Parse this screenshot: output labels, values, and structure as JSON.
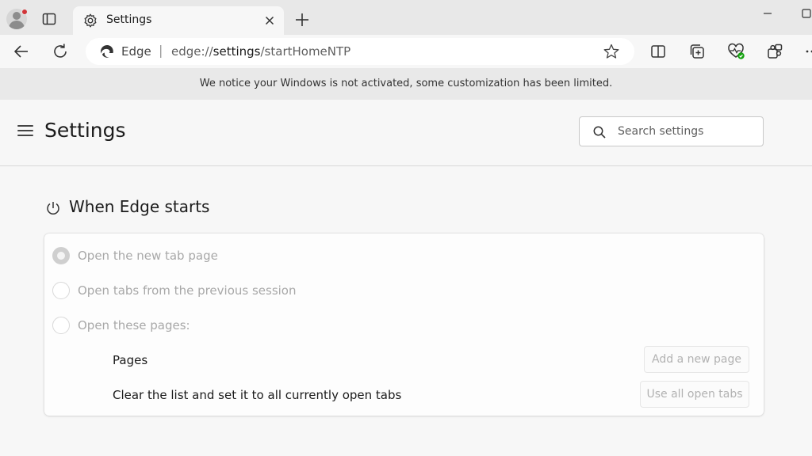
{
  "tabstrip": {
    "tab_title": "Settings"
  },
  "toolbar": {
    "site_label": "Edge",
    "url_prefix": "edge://",
    "url_host": "settings",
    "url_path": "/startHomeNTP"
  },
  "notice": {
    "text": "We notice your Windows is not activated, some customization has been limited."
  },
  "header": {
    "title": "Settings",
    "search_placeholder": "Search settings"
  },
  "section": {
    "title": "When Edge starts",
    "options": [
      {
        "label": "Open the new tab page",
        "selected": true
      },
      {
        "label": "Open tabs from the previous session",
        "selected": false
      },
      {
        "label": "Open these pages:",
        "selected": false
      }
    ],
    "pages_label": "Pages",
    "add_page_button": "Add a new page",
    "clear_list_label": "Clear the list and set it to all currently open tabs",
    "use_open_tabs_button": "Use all open tabs"
  },
  "colors": {
    "accent_disabled": "#cfcfcf",
    "status_badge": "#13a10e",
    "profile_badge": "#d13438"
  }
}
